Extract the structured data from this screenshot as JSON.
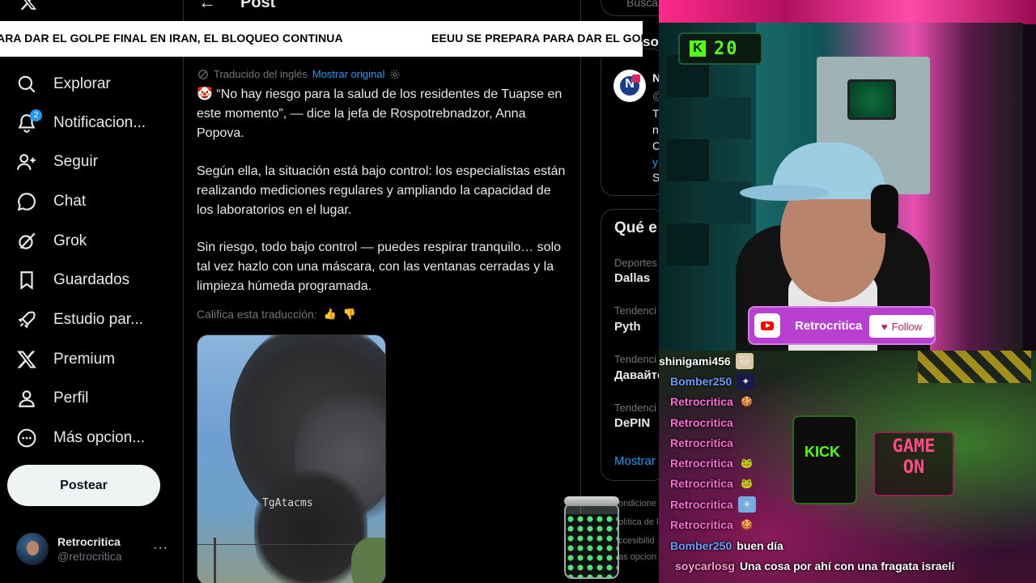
{
  "colors": {
    "accent": "#1d9bf0",
    "kick_green": "#53fc18"
  },
  "sidebar": {
    "items": [
      {
        "label": "Explorar",
        "icon": "search-icon"
      },
      {
        "label": "Notificacion...",
        "icon": "bell-icon",
        "badge": "2"
      },
      {
        "label": "Seguir",
        "icon": "add-person-icon"
      },
      {
        "label": "Chat",
        "icon": "chat-bubble-icon"
      },
      {
        "label": "Grok",
        "icon": "grok-icon"
      },
      {
        "label": "Guardados",
        "icon": "bookmark-icon"
      },
      {
        "label": "Estudio par...",
        "icon": "rocket-icon"
      },
      {
        "label": "Premium",
        "icon": "x-logo-icon"
      },
      {
        "label": "Perfil",
        "icon": "person-icon"
      },
      {
        "label": "Más opcion...",
        "icon": "more-circle-icon"
      }
    ],
    "post_button": "Postear",
    "profile": {
      "display_name": "Retrocritica",
      "handle": "@retrocritica",
      "more": "···"
    }
  },
  "header": {
    "back": "←",
    "title": "Post"
  },
  "ticker": {
    "text_a": "ARA DAR EL GOLPE FINAL EN IRAN, EL BLOQUEO CONTINUA",
    "text_b": "EEUU SE PREPARA PARA DAR EL GOLPE",
    "tail": "so"
  },
  "post": {
    "translated_label": "Traducido del inglés",
    "show_original": "Mostrar original",
    "paragraph_1": "🤡 “No hay riesgo para la salud de los residentes de Tuapse en este momento”, — dice la jefa de Rospotrebnadzor, Anna Popova.",
    "paragraph_2": "Según ella, la situación está bajo control: los especialistas están realizando mediciones regulares y ampliando la capacidad de los laboratorios en el lugar.",
    "paragraph_3": "Sin riesgo, todo bajo control — puedes respirar tranquilo… solo tal vez hazlo con una máscara, con las ventanas cerradas y la limpieza húmeda programada.",
    "rate_label": "Califica esta traducción:",
    "thumb_up": "👍",
    "thumb_down": "👎",
    "media_watermark": "TgAtacms"
  },
  "right": {
    "search_placeholder": "Busca",
    "news_logo_letter": "N",
    "news_fragments": [
      "N",
      "@",
      "T",
      "n",
      "C",
      "y",
      "S"
    ],
    "what_title": "Qué e",
    "trends": [
      {
        "category": "Deportes",
        "name": "Dallas"
      },
      {
        "category": "Tendenci",
        "name": "Pyth"
      },
      {
        "category": "Tendenci",
        "name": "Давайте"
      },
      {
        "category": "Tendenci",
        "name": "DePIN"
      }
    ],
    "show_more": "Mostrar",
    "footer": [
      "ondicione",
      "olítica de l",
      "ccesibilid",
      "as opcion"
    ]
  },
  "stream": {
    "kick_counter": {
      "k": "K",
      "value": "20"
    },
    "channel": "Retrocritica",
    "follow": "Follow",
    "mug_text": "KICK",
    "sign_text": "GAME ON",
    "chat": [
      {
        "user": "shinigami456",
        "color": "#ffffff",
        "emote": "cat",
        "msg": ""
      },
      {
        "user": "Bomber250",
        "color": "#6a9cff",
        "emote": "sparkle",
        "msg": ""
      },
      {
        "user": "Retrocritica",
        "color": "#ff6ad5",
        "emote": "cookie",
        "msg": ""
      },
      {
        "user": "Retrocritica",
        "color": "#ff6ad5",
        "emote": "",
        "msg": ""
      },
      {
        "user": "Retrocritica",
        "color": "#ff6ad5",
        "emote": "",
        "msg": ""
      },
      {
        "user": "Retrocritica",
        "color": "#ff6ad5",
        "emote": "frog",
        "msg": ""
      },
      {
        "user": "Retrocritica",
        "color": "#ff6ad5",
        "emote": "frog",
        "msg": ""
      },
      {
        "user": "Retrocritica",
        "color": "#ff6ad5",
        "emote": "argentina-flag",
        "msg": ""
      },
      {
        "user": "Retrocritica",
        "color": "#ff6ad5",
        "emote": "cookie",
        "msg": ""
      },
      {
        "user": "Bomber250",
        "color": "#6a9cff",
        "emote": "",
        "msg": "buen día"
      },
      {
        "user": "soycarlosg",
        "color": "#ff9ad0",
        "emote": "",
        "msg": "Una cosa por ahí con una fragata israelí"
      }
    ]
  }
}
